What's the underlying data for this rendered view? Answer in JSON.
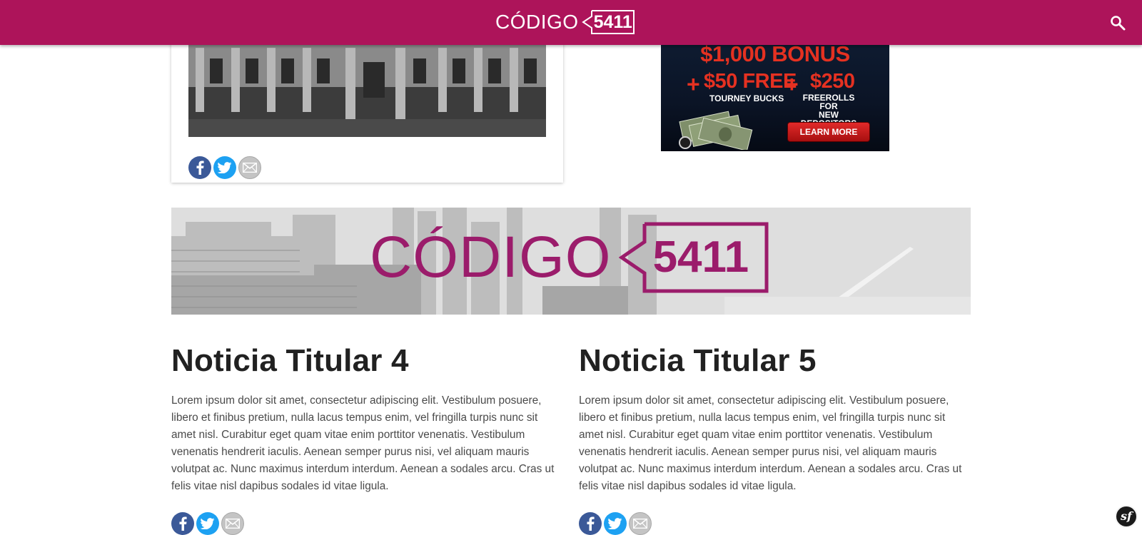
{
  "header": {
    "brand_word": "CÓDIGO",
    "brand_number": "5411",
    "search_icon": "search-icon",
    "bg_color": "#ad145a"
  },
  "card": {
    "photo": "building-photo",
    "share": [
      "facebook-icon",
      "twitter-icon",
      "email-icon"
    ]
  },
  "ad": {
    "bonus": "$1,000 BONUS",
    "plus": "+",
    "free": "$50 FREE",
    "amount": "$250",
    "tourney": "TOURNEY BUCKS",
    "freerolls_line1": "FREEROLLS FOR",
    "freerolls_line2": "NEW DEPOSITORS",
    "cta": "LEARN MORE"
  },
  "banner": {
    "brand_word": "CÓDIGO",
    "brand_number": "5411",
    "brand_color": "#9b1c6b"
  },
  "articles": [
    {
      "title": "Noticia Titular 4",
      "body": "Lorem ipsum dolor sit amet, consectetur adipiscing elit. Vestibulum posuere, libero et finibus pretium, nulla lacus tempus enim, vel fringilla turpis nunc sit amet nisl. Curabitur eget quam vitae enim porttitor venenatis. Vestibulum venenatis hendrerit iaculis. Aenean semper purus nisi, vel aliquam mauris volutpat ac. Nunc maximus interdum interdum. Aenean a sodales arcu. Cras ut felis vitae nisl dapibus sodales id vitae ligula."
    },
    {
      "title": "Noticia Titular 5",
      "body": "Lorem ipsum dolor sit amet, consectetur adipiscing elit. Vestibulum posuere, libero et finibus pretium, nulla lacus tempus enim, vel fringilla turpis nunc sit amet nisl. Curabitur eget quam vitae enim porttitor venenatis. Vestibulum venenatis hendrerit iaculis. Aenean semper purus nisi, vel aliquam mauris volutpat ac. Nunc maximus interdum interdum. Aenean a sodales arcu. Cras ut felis vitae nisl dapibus sodales id vitae ligula."
    }
  ],
  "toolbar_badge": "sf"
}
